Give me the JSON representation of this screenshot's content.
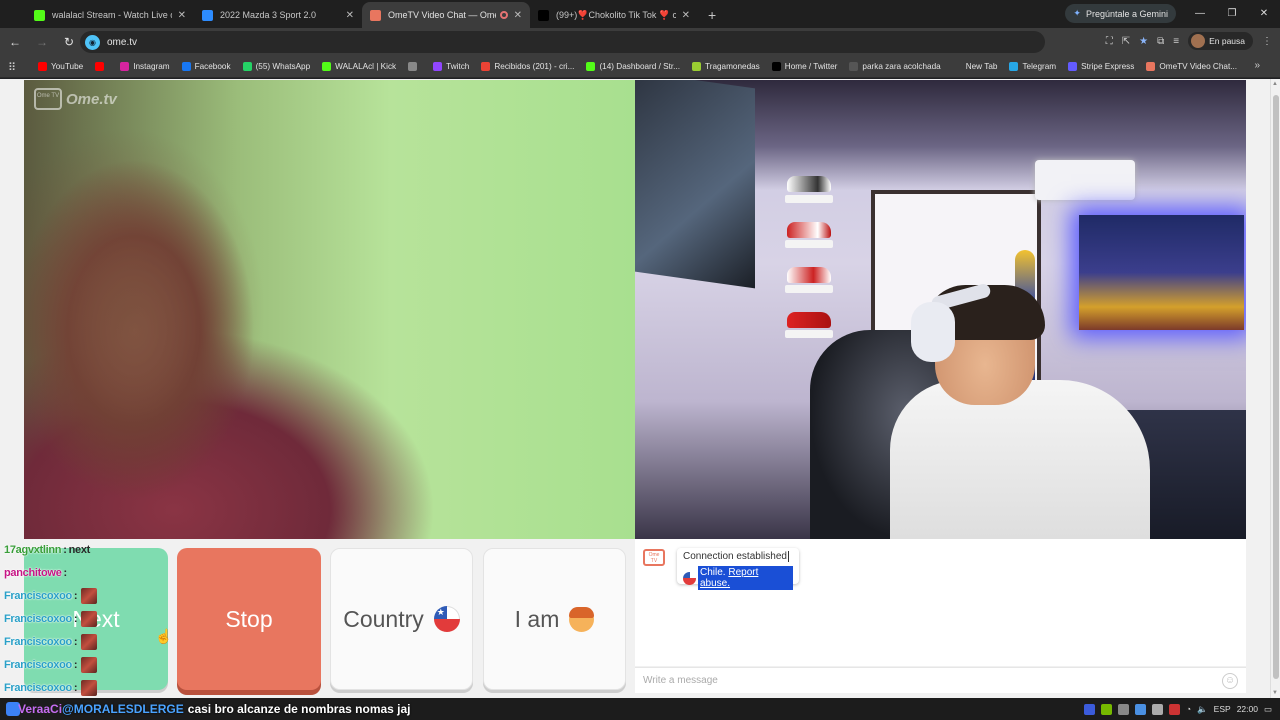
{
  "browser": {
    "tabs": [
      {
        "title": "walalacl Stream - Watch Live o",
        "favicon_color": "#53fc18",
        "active": false
      },
      {
        "title": "2022 Mazda 3 Sport 2.0",
        "favicon_color": "#2d8cff",
        "active": false
      },
      {
        "title": "OmeTV Video Chat — Ome",
        "favicon_color": "#e8765f",
        "active": true
      },
      {
        "title": "(99+)❣️Chokolito Tik Tok ❣️ cu",
        "favicon_color": "#000000",
        "active": false
      }
    ],
    "gemini_label": "Pregúntale a Gemini",
    "url": "ome.tv",
    "profile_status": "En pausa",
    "bookmarks": [
      {
        "label": "YouTube",
        "color": "#ff0000"
      },
      {
        "label": "",
        "color": "#ff0000"
      },
      {
        "label": "Instagram",
        "color": "#d6249f"
      },
      {
        "label": "Facebook",
        "color": "#1877f2"
      },
      {
        "label": "(55) WhatsApp",
        "color": "#25d366"
      },
      {
        "label": "WALALAcl | Kick",
        "color": "#53fc18"
      },
      {
        "label": "",
        "color": "#888888"
      },
      {
        "label": "Twitch",
        "color": "#9146ff"
      },
      {
        "label": "Recibidos (201) - cri...",
        "color": "#ea4335"
      },
      {
        "label": "(14) Dashboard / Str...",
        "color": "#53fc18"
      },
      {
        "label": "Tragamonedas",
        "color": "#9acd32"
      },
      {
        "label": "Home / Twitter",
        "color": "#000000"
      },
      {
        "label": "parka zara acolchada",
        "color": "#555555"
      },
      {
        "label": "New Tab",
        "color": "#3c3c3c"
      },
      {
        "label": "Telegram",
        "color": "#27a7e7"
      },
      {
        "label": "Stripe Express",
        "color": "#635bff"
      },
      {
        "label": "OmeTV Video Chat...",
        "color": "#e8765f"
      }
    ]
  },
  "ometv": {
    "logo_text": "Ome.tv",
    "logo_badge": "Ome TV",
    "buttons": {
      "next": "Next",
      "stop": "Stop",
      "country": "Country",
      "iam": "I am"
    },
    "chat": {
      "system_line1": "Connection established",
      "country": "Chile.",
      "report": "Report abuse.",
      "input_placeholder": "Write a message"
    }
  },
  "stream_chat": [
    {
      "user": "17agvxtlinn",
      "user_color": "#3a9e3a",
      "message": "next",
      "emote": false
    },
    {
      "user": "panchitowe",
      "user_color": "#c71585",
      "message": "",
      "emote": false
    },
    {
      "user": "Franciscoxoo",
      "user_color": "#2aa0c8",
      "message": "",
      "emote": true
    },
    {
      "user": "Franciscoxoo",
      "user_color": "#2aa0c8",
      "message": "",
      "emote": true
    },
    {
      "user": "Franciscoxoo",
      "user_color": "#2aa0c8",
      "message": "",
      "emote": true
    },
    {
      "user": "Franciscoxoo",
      "user_color": "#2aa0c8",
      "message": "",
      "emote": true
    },
    {
      "user": "Franciscoxoo",
      "user_color": "#2aa0c8",
      "message": "",
      "emote": true
    }
  ],
  "ticker": {
    "prefix": "VeraaCi",
    "user": "@MORALESDLERGE",
    "message": "casi bro alcanze de nombras nomas jaj"
  },
  "taskbar": {
    "lang": "ESP",
    "time": "22:00"
  }
}
